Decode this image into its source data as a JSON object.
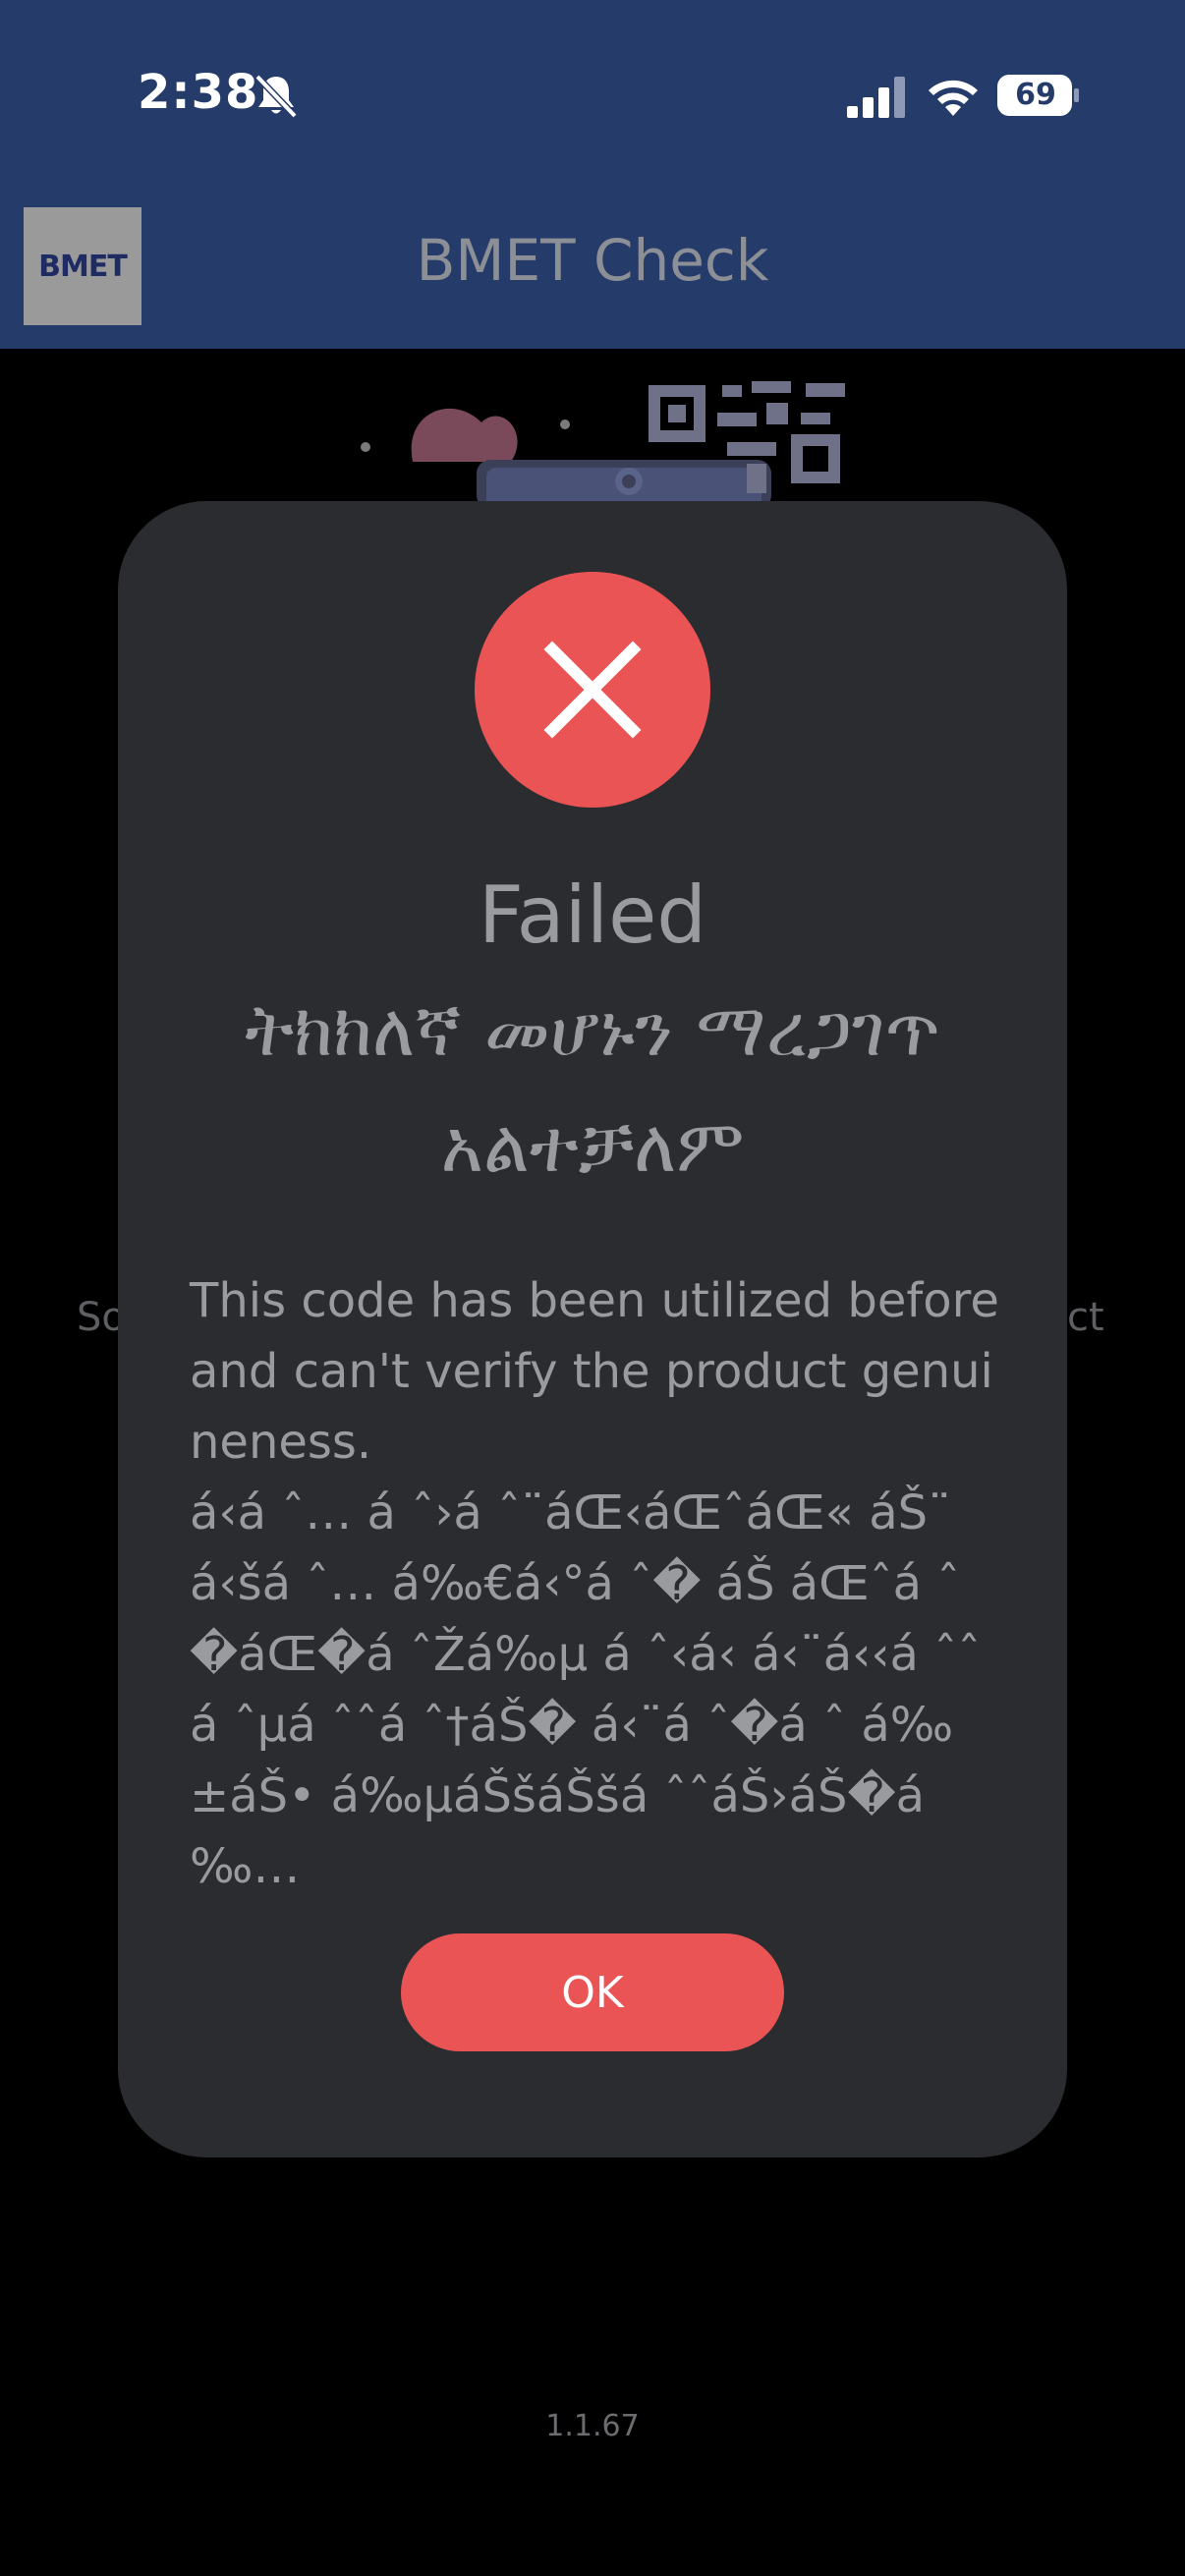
{
  "status_bar": {
    "time": "2:38",
    "battery": "69",
    "icons": [
      "silent-bell-icon",
      "cellular-signal-icon",
      "wifi-icon",
      "battery-icon"
    ]
  },
  "app_bar": {
    "logo_text": "BMET",
    "title": "BMET Check"
  },
  "background": {
    "text_left_fragment": "So",
    "text_right_fragment": "ct",
    "version": "1.1.67"
  },
  "dialog": {
    "icon": "close-x-icon",
    "title": "Failed",
    "subtitle": "ትክክለኛ መሆኑን ማረጋገጥ አልተቻለም",
    "message_en": "This code has been utilized before and can't verify the product genuineness.",
    "message_garbled": "á‹á ˆ… á ˆ›á ˆ¨áŒ‹áŒˆáŒ« áŠ¨á‹šá ˆ… á‰€á‹°á ˆ� áŠ áŒˆá ˆ�áŒ�á ˆŽá‰µ á ˆ‹á‹ á‹¨á‹‹á ˆˆ á ˆµá ˆˆá ˆ†áŠ� á‹¨á ˆ�á ˆ á‰±áŠ• á‰µáŠšáŠšá ˆˆáŠ›áŠ�á ‰…",
    "ok_label": "OK"
  },
  "colors": {
    "header_bg": "#253c6b",
    "dialog_bg": "#2b2c30",
    "accent_red": "#ea5455",
    "text_gray": "#9a9b9f"
  }
}
